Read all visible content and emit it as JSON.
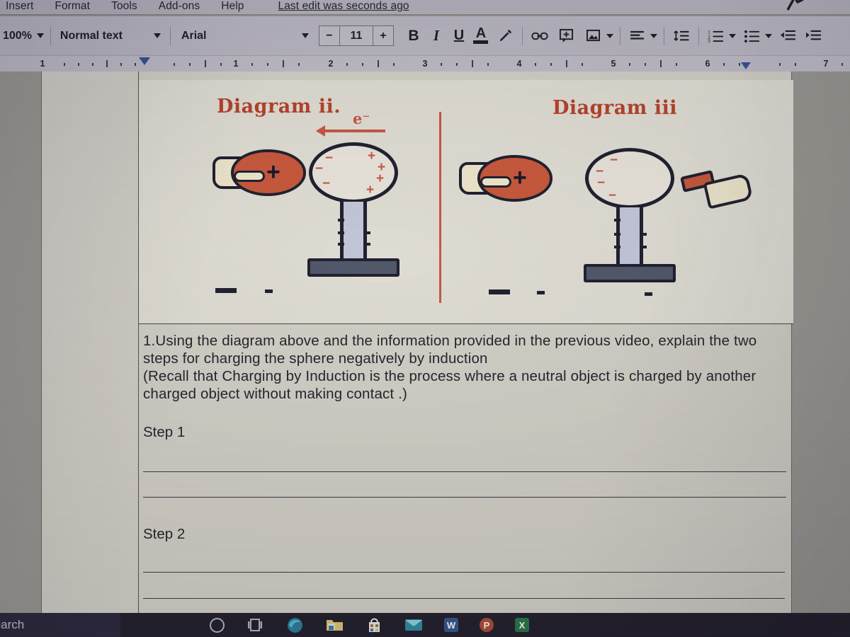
{
  "app": {
    "name": "Google Docs",
    "menu_items": [
      "Insert",
      "Format",
      "Tools",
      "Add-ons",
      "Help"
    ],
    "last_edit": "Last edit was seconds ago"
  },
  "toolbar": {
    "zoom": "100%",
    "paragraph_style": "Normal text",
    "font_family": "Arial",
    "font_size": "11",
    "size_minus": "−",
    "size_plus": "+",
    "bold": "B",
    "italic": "I",
    "underline": "U",
    "text_color": "A",
    "highlight": "highlight-pen-icon",
    "insert_link": "link-icon",
    "add_comment": "comment-icon",
    "insert_image": "image-icon",
    "align": "align-left-icon",
    "line_spacing": "line-spacing-icon",
    "numbered_list": "numbered-list-icon",
    "bulleted_list": "bulleted-list-icon",
    "decrease_indent": "decrease-indent-icon",
    "increase_indent": "increase-indent-icon"
  },
  "ruler": {
    "unit": "inches",
    "left_numbers": [
      "1"
    ],
    "numbers": [
      "1",
      "2",
      "3",
      "4",
      "5",
      "6",
      "7"
    ],
    "left_indent_marker": true,
    "right_indent_marker": true
  },
  "document": {
    "figure": {
      "caption_left": "Diagram ii.",
      "caption_right": "Diagram iii",
      "divider_color": "#e0503a",
      "accent_color": "#cf3a1f",
      "left_panel": {
        "rod_label": "+",
        "sphere_left_marks": [
          "−",
          "−",
          "−"
        ],
        "sphere_right_marks": [
          "+",
          "+",
          "+",
          "+"
        ],
        "electron_arrow_label": "e⁻"
      },
      "right_panel": {
        "rod_label": "+",
        "sphere_left_marks": [
          "−",
          "−",
          "−",
          "−"
        ],
        "grounding_hand": true
      }
    },
    "body": [
      "1.Using the diagram above and the information provided in the previous video, explain the two steps for charging the sphere negatively by induction",
      "(Recall that Charging by Induction is the process where  a neutral object is charged by another charged object without making contact .)"
    ],
    "step_1_label": "Step 1",
    "step_2_label": "Step 2",
    "answer_lines": 4
  },
  "taskbar": {
    "search_placeholder": "Type here to search",
    "items": [
      {
        "name": "cortana-icon",
        "label": ""
      },
      {
        "name": "task-view-icon",
        "label": ""
      },
      {
        "name": "edge-icon",
        "label": ""
      },
      {
        "name": "file-explorer-icon",
        "label": ""
      },
      {
        "name": "microsoft-store-icon",
        "label": ""
      },
      {
        "name": "mail-icon",
        "label": ""
      },
      {
        "name": "word-icon",
        "label": "W"
      },
      {
        "name": "powerpoint-icon",
        "label": "P"
      },
      {
        "name": "excel-icon",
        "label": "X"
      }
    ]
  }
}
